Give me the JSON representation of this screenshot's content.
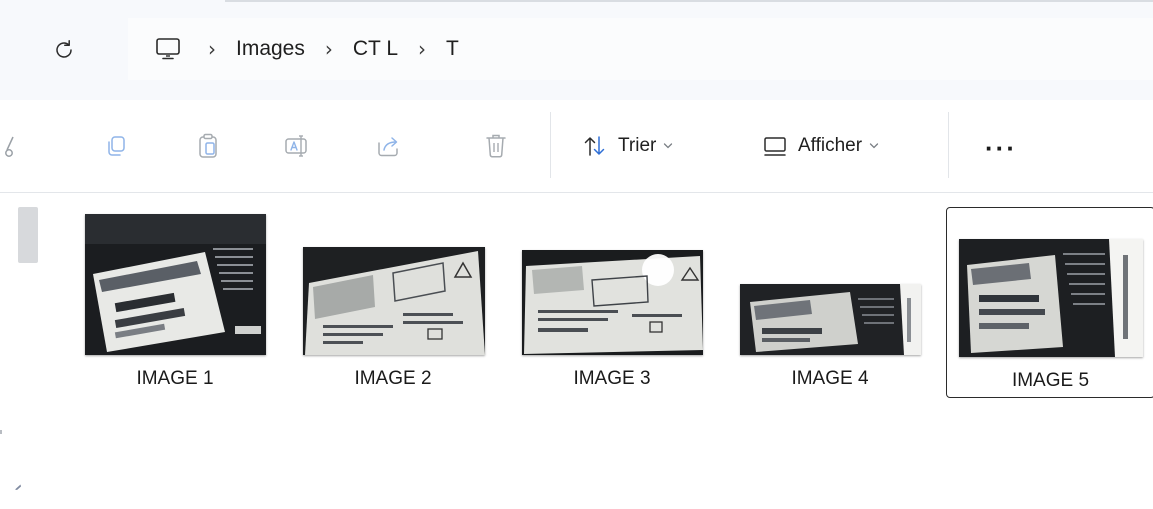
{
  "toolbar": {
    "refresh_icon": "refresh-icon",
    "breadcrumb": {
      "root_icon": "this-pc-monitor-icon",
      "separator": "›",
      "items": [
        "Images",
        "CT L",
        "T"
      ]
    }
  },
  "commands": {
    "icons": [
      "cut-icon",
      "copy-icon",
      "paste-icon",
      "rename-icon",
      "share-icon",
      "delete-icon"
    ],
    "sort": {
      "label": "Trier",
      "icon": "sort-icon"
    },
    "view": {
      "label": "Afficher",
      "icon": "view-icon"
    },
    "more": "···"
  },
  "files": [
    {
      "name": "IMAGE 1",
      "selected": false
    },
    {
      "name": "IMAGE 2",
      "selected": false
    },
    {
      "name": "IMAGE 3",
      "selected": false
    },
    {
      "name": "IMAGE 4",
      "selected": false
    },
    {
      "name": "IMAGE 5",
      "selected": true
    }
  ],
  "colors": {
    "accent": "#2f6fd6",
    "chrome_background": "#f7f9fc",
    "selection_border": "#2b2b2b"
  }
}
